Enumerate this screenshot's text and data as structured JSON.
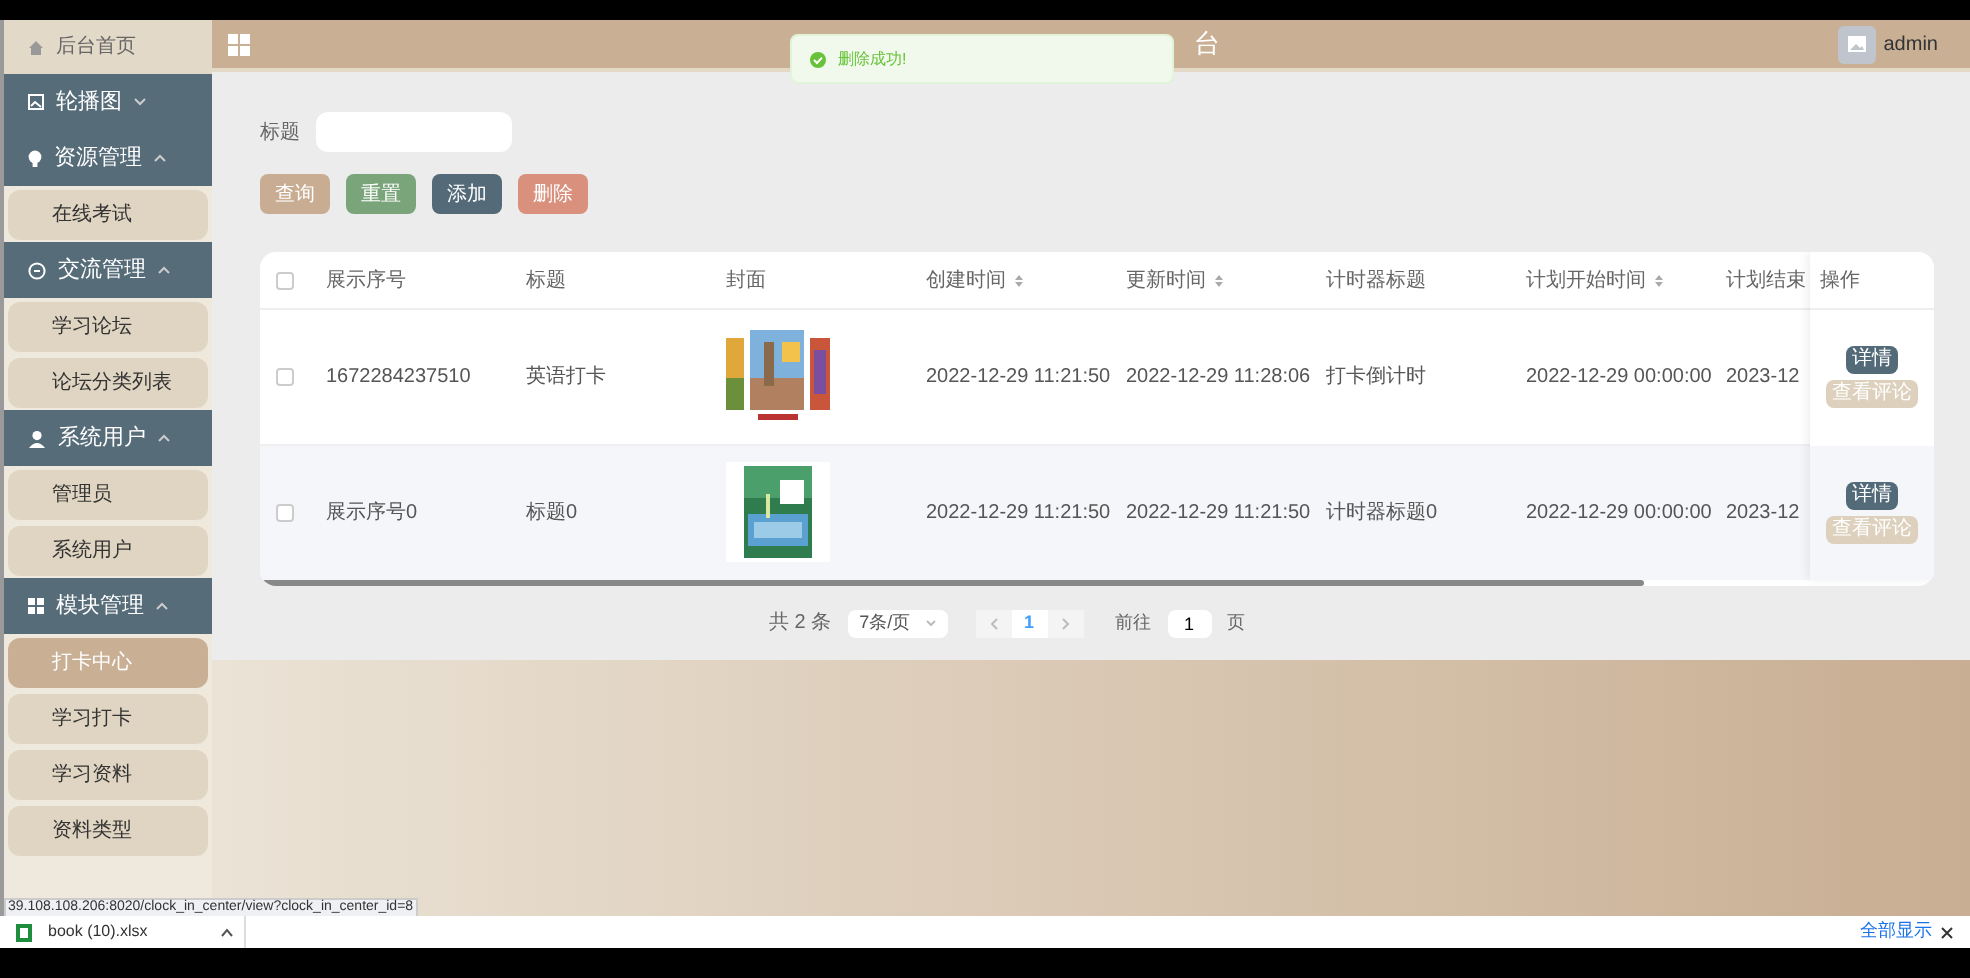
{
  "header": {
    "title": "台",
    "user": "admin"
  },
  "toast": {
    "message": "删除成功!"
  },
  "sidebar": {
    "items": [
      {
        "kind": "home",
        "label": "后台首页",
        "selected": false
      },
      {
        "kind": "group",
        "label": "轮播图",
        "expanded": false
      },
      {
        "kind": "group",
        "label": "资源管理",
        "expanded": true,
        "children": [
          {
            "label": "在线考试",
            "selected": false
          }
        ]
      },
      {
        "kind": "group",
        "label": "交流管理",
        "expanded": true,
        "children": [
          {
            "label": "学习论坛",
            "selected": false
          },
          {
            "label": "论坛分类列表",
            "selected": false
          }
        ]
      },
      {
        "kind": "group",
        "label": "系统用户",
        "expanded": true,
        "children": [
          {
            "label": "管理员",
            "selected": false
          },
          {
            "label": "系统用户",
            "selected": false
          }
        ]
      },
      {
        "kind": "group",
        "label": "模块管理",
        "expanded": true,
        "children": [
          {
            "label": "打卡中心",
            "selected": true
          },
          {
            "label": "学习打卡",
            "selected": false
          },
          {
            "label": "学习资料",
            "selected": false
          },
          {
            "label": "资料类型",
            "selected": false
          }
        ]
      }
    ]
  },
  "search": {
    "label": "标题"
  },
  "buttons": [
    {
      "kind": "query",
      "label": "查询",
      "disabled": false
    },
    {
      "kind": "reset",
      "label": "重置",
      "disabled": false
    },
    {
      "kind": "add",
      "label": "添加",
      "disabled": false
    },
    {
      "kind": "delete",
      "label": "删除",
      "disabled": false
    }
  ],
  "table": {
    "all_checked": false,
    "columns": [
      {
        "label": "展示序号",
        "sortable": false
      },
      {
        "label": "标题",
        "sortable": false
      },
      {
        "label": "封面",
        "sortable": false
      },
      {
        "label": "创建时间",
        "sortable": true
      },
      {
        "label": "更新时间",
        "sortable": true
      },
      {
        "label": "计时器标题",
        "sortable": false
      },
      {
        "label": "计划开始时间",
        "sortable": true
      },
      {
        "label": "计划结束"
      }
    ],
    "action_column": "操作",
    "rows": [
      {
        "checked": false,
        "cells": [
          "1672284237510",
          "英语打卡",
          {
            "kind": "picture"
          },
          "2022-12-29 11:21:50",
          "2022-12-29 11:28:06",
          "打卡倒计时",
          "2022-12-29 00:00:00",
          "2023-12"
        ],
        "actions": [
          "详情",
          "查看评论"
        ]
      },
      {
        "checked": false,
        "cells": [
          "展示序号0",
          "标题0",
          {
            "kind": "picture"
          },
          "2022-12-29 11:21:50",
          "2022-12-29 11:21:50",
          "计时器标题0",
          "2022-12-29 00:00:00",
          "2023-12"
        ],
        "actions": [
          "详情",
          "查看评论"
        ]
      }
    ]
  },
  "pagination": {
    "total": "共 2 条",
    "page_size": "7条/页",
    "current_page": "1",
    "goto_label": "前往",
    "goto_value": "1",
    "page_suffix": "页"
  },
  "status_url": "39.108.108.206:8020/clock_in_center/view?clock_in_center_id=8",
  "download_bar": {
    "file": "book (10).xlsx",
    "show_all": "全部显示"
  }
}
